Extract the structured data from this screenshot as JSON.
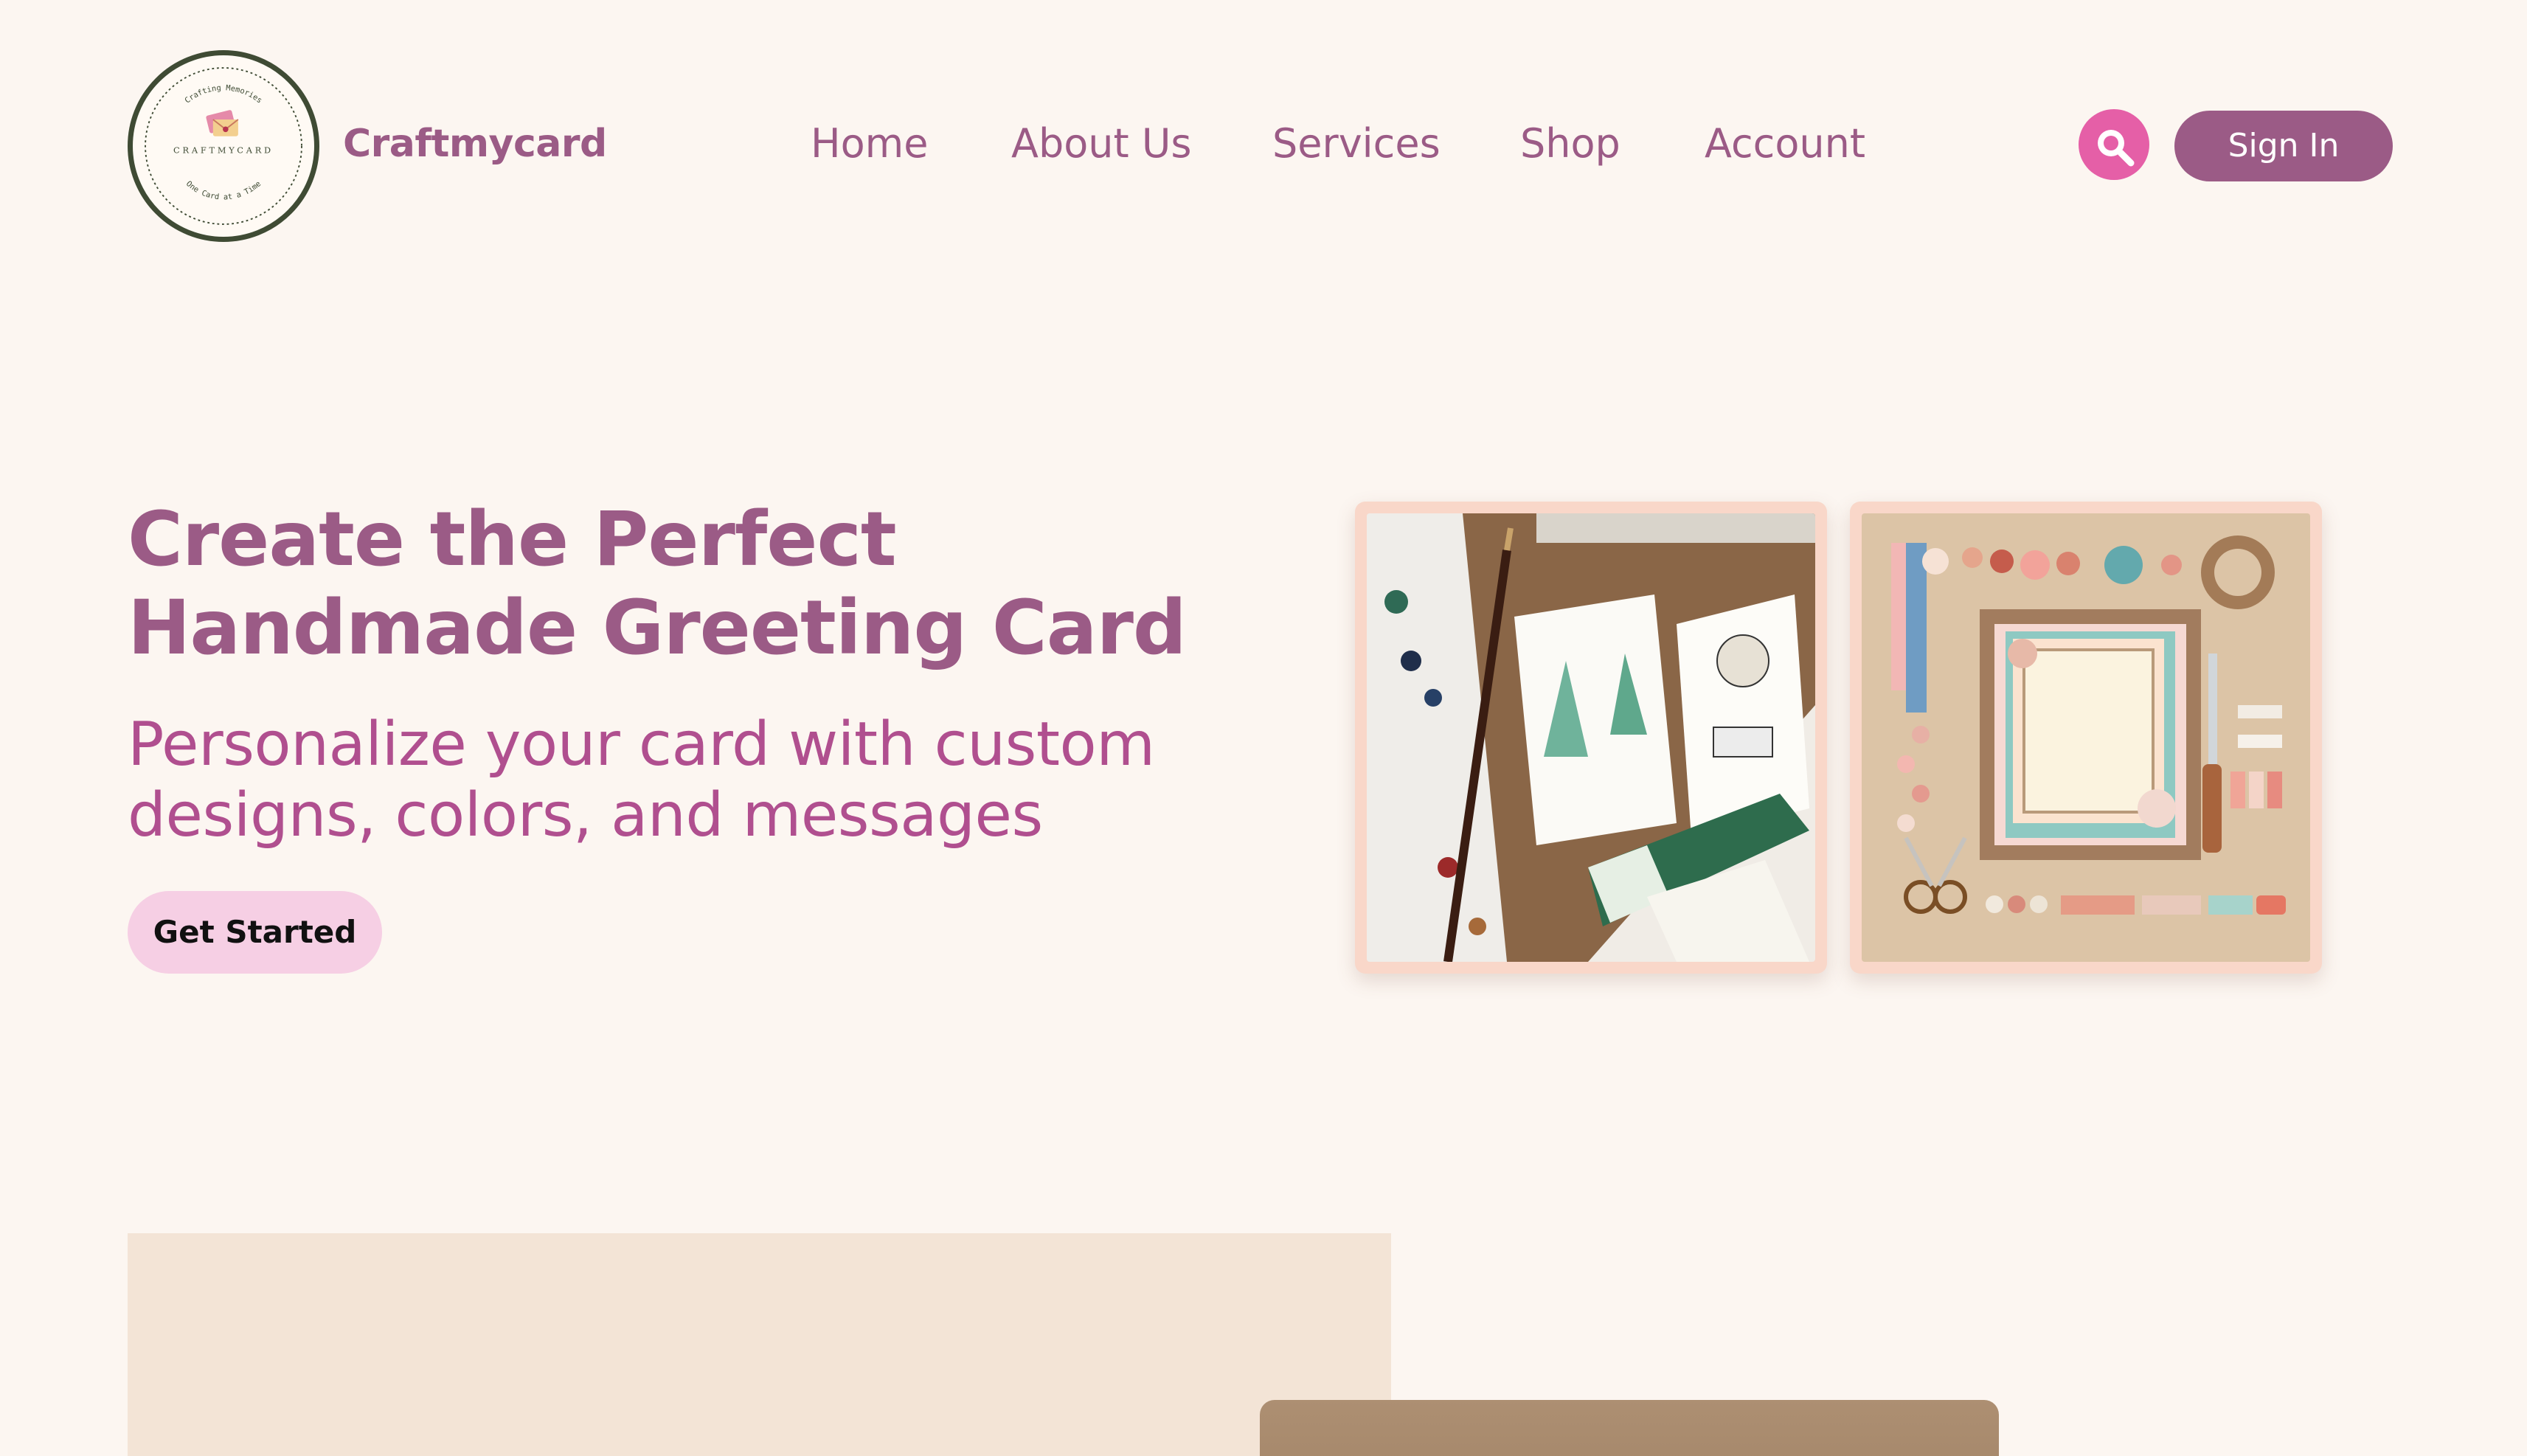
{
  "header": {
    "brand": "Craftmycard",
    "logo": {
      "top_text": "Crafting Memories",
      "center_text": "CRAFTMYCARD",
      "bottom_text": "One Card at a Time",
      "icon": "envelope-icon"
    },
    "nav": [
      {
        "id": "home",
        "label": "Home"
      },
      {
        "id": "about",
        "label": "About Us"
      },
      {
        "id": "services",
        "label": "Services"
      },
      {
        "id": "shop",
        "label": "Shop"
      },
      {
        "id": "account",
        "label": "Account"
      }
    ],
    "search_icon": "search-icon",
    "signin_label": "Sign In"
  },
  "hero": {
    "title_lines": [
      "Create the Perfect",
      "Handmade Greeting Card"
    ],
    "subtitle_lines": [
      "Personalize your card with custom",
      "designs, colors, and messages"
    ],
    "cta_label": "Get Started"
  },
  "colors": {
    "background": "#fcf6f1",
    "brand": "#9b5b86",
    "subtitle": "#b04f8f",
    "search_button": "#e55fa7",
    "cta_button": "#f6cfe4",
    "logo_ring": "#3f4b34",
    "lower_panel": "#f3e4d6"
  }
}
